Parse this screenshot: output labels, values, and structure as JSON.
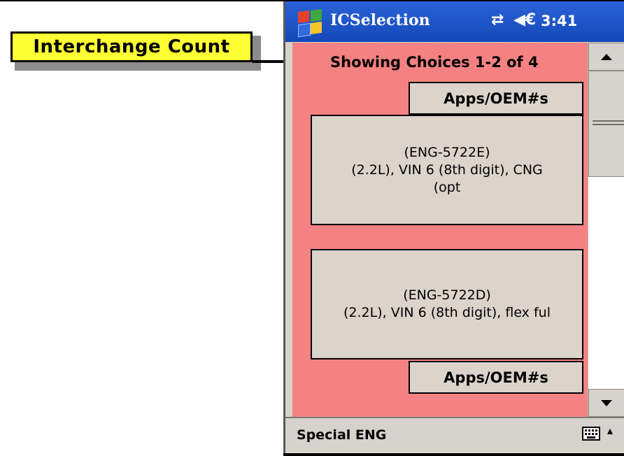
{
  "callout": {
    "label": "Interchange Count"
  },
  "titlebar": {
    "title": "ICSelection",
    "connectivity_icon": "connectivity-icon",
    "volume_icon": "volume-icon",
    "connectivity_glyph": "⇄",
    "volume_glyph": "◀€",
    "time": "3:41"
  },
  "content": {
    "showing_text": "Showing Choices 1-2 of 4",
    "apps_button_label": "Apps/OEM#s",
    "choices": [
      {
        "line1": "(ENG-5722E)",
        "line2": "(2.2L), VIN 6 (8th digit), CNG",
        "line3": "(opt"
      },
      {
        "line1": "(ENG-5722D)",
        "line2": "(2.2L), VIN 6 (8th digit), flex ful",
        "line3": ""
      }
    ]
  },
  "menubar": {
    "left_label": "Special ENG",
    "keyboard_icon": "keyboard-icon",
    "sip_glyph": "▴"
  },
  "colors": {
    "content_bg": "#f48282",
    "button_bg": "#dcd3cb",
    "titlebar": "#1f56c8",
    "callout": "#ffff33"
  }
}
